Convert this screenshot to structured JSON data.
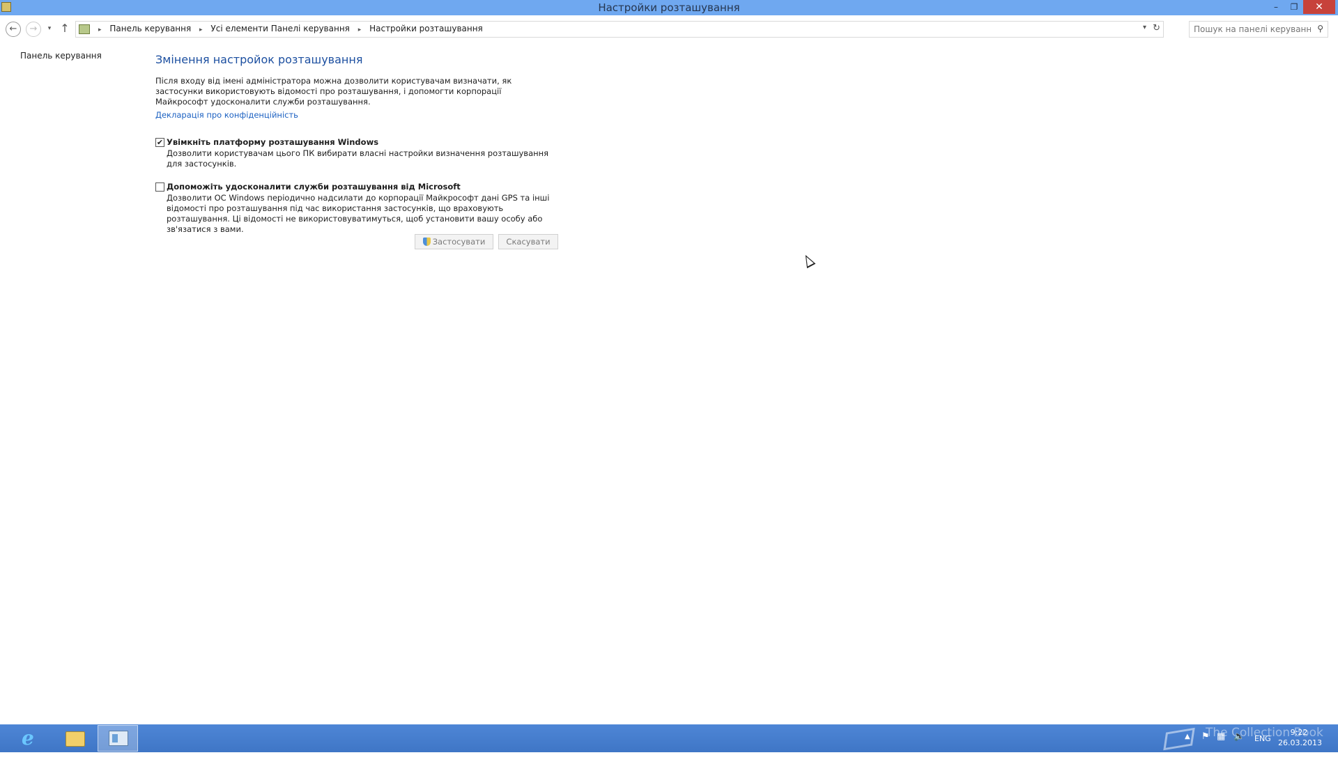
{
  "window": {
    "title": "Настройки розташування",
    "controls": {
      "minimize": "–",
      "restore": "❐",
      "close": "✕"
    }
  },
  "navbar": {
    "back_icon": "←",
    "forward_icon": "→",
    "recent_icon": "▾",
    "up_icon": "↑",
    "breadcrumb": [
      "Панель керування",
      "Усі елементи Панелі керування",
      "Настройки розташування"
    ],
    "separator": "▸",
    "dropdown_icon": "▾",
    "refresh_icon": "↻"
  },
  "search": {
    "placeholder": "Пошук на панелі керування",
    "icon": "⚲"
  },
  "sidebar": {
    "link": "Панель керування"
  },
  "main": {
    "title": "Змінення настройок розташування",
    "description": "Після входу від імені адміністратора можна дозволити користувачам визначати, як застосунки використовують відомості про розташування, і допомогти корпорації Майкрософт удосконалити служби розташування.",
    "privacy_link": "Декларація про конфіденційність",
    "options": [
      {
        "label": "Увімкніть платформу розташування Windows",
        "description": "Дозволити користувачам цього ПК вибирати власні настройки визначення розташування для застосунків.",
        "checked": true,
        "check_glyph": "✔"
      },
      {
        "label": "Допоможіть удосконалити служби розташування від Microsoft",
        "description": "Дозволити ОС Windows періодично надсилати до корпорації Майкрософт дані GPS та інші відомості про розташування під час використання застосунків, що враховують розташування. Ці відомості не використовуватимуться, щоб установити вашу особу або зв'язатися з вами.",
        "checked": false,
        "check_glyph": ""
      }
    ],
    "apply_button": "Застосувати",
    "cancel_button": "Скасувати"
  },
  "taskbar": {
    "apps": [
      {
        "name": "Internet Explorer",
        "icon": "ie-icon",
        "glyph": "e"
      },
      {
        "name": "File Explorer",
        "icon": "folder-icon"
      },
      {
        "name": "Control Panel",
        "icon": "control-panel-icon",
        "active": true
      }
    ],
    "tray": {
      "chevron": "▲",
      "flag_icon": "⚑",
      "network_icon": "▦",
      "speaker_icon": "🔈",
      "language": "ENG",
      "time": "9:22",
      "date": "26.03.2013"
    },
    "watermark": "The Collection Book"
  }
}
